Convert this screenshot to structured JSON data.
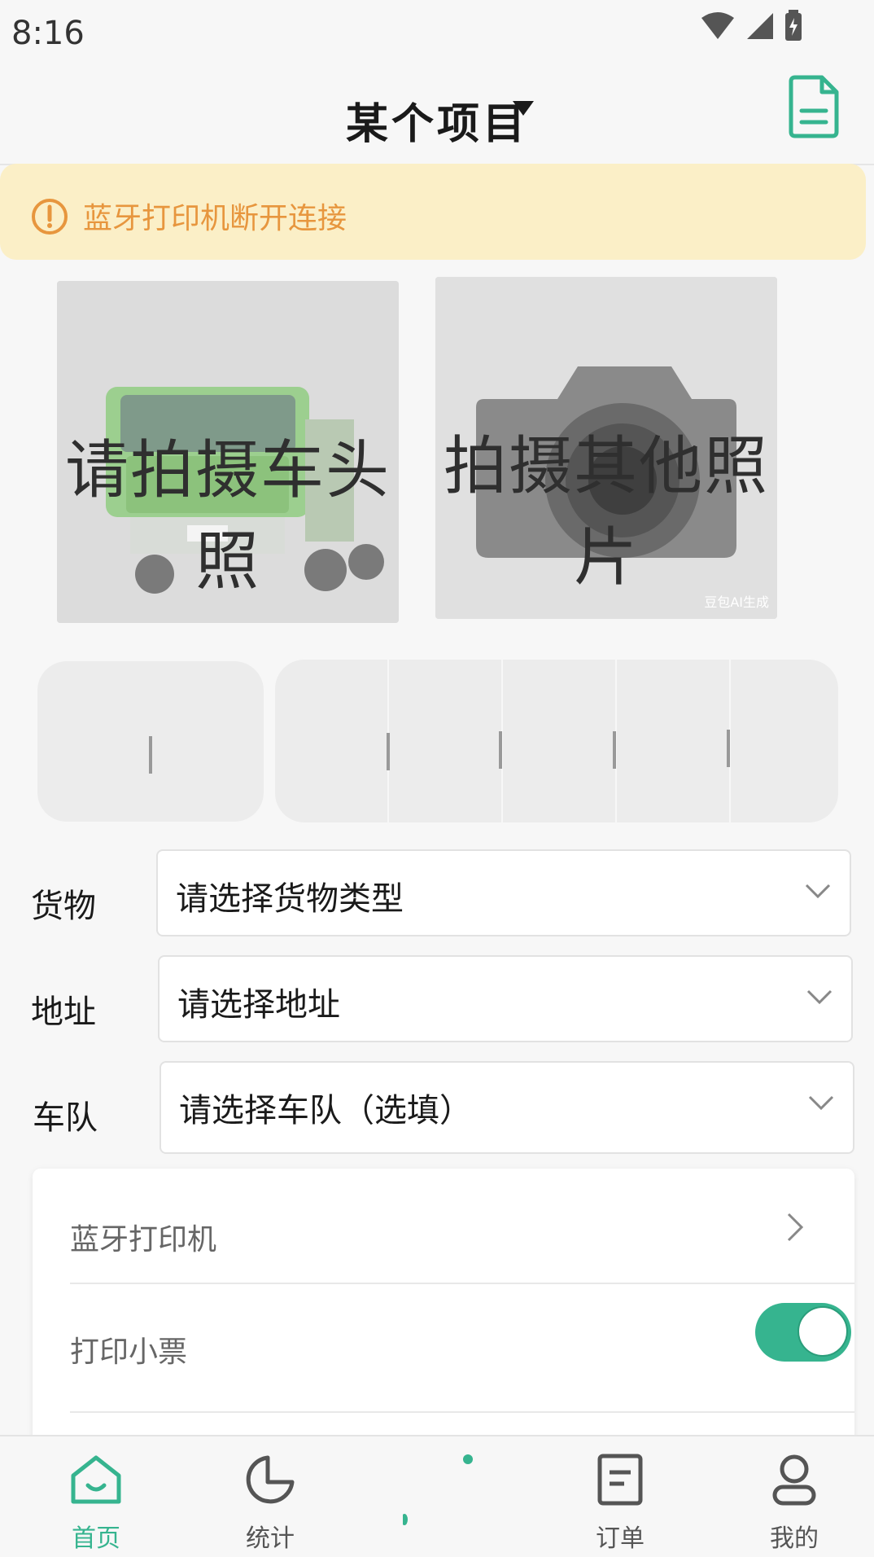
{
  "status": {
    "time": "8:16"
  },
  "header": {
    "title": "某个项目"
  },
  "banner": {
    "text": "蓝牙打印机断开连接"
  },
  "photos": {
    "front": {
      "label": "请拍摄车头照"
    },
    "other": {
      "label": "拍摄其他照片",
      "watermark": "豆包AI生成"
    }
  },
  "form": {
    "cargo": {
      "label": "货物",
      "placeholder": "请选择货物类型"
    },
    "address": {
      "label": "地址",
      "placeholder": "请选择地址"
    },
    "fleet": {
      "label": "车队",
      "placeholder": "请选择车队（选填）"
    }
  },
  "settings": {
    "printer": {
      "label": "蓝牙打印机"
    },
    "receipt": {
      "label": "打印小票",
      "enabled": true
    }
  },
  "nav": {
    "home": "首页",
    "stats": "统计",
    "orders": "订单",
    "mine": "我的"
  },
  "colors": {
    "accent": "#36b48f",
    "warning_bg": "#fbefc7",
    "warning_text": "#e7963e"
  }
}
